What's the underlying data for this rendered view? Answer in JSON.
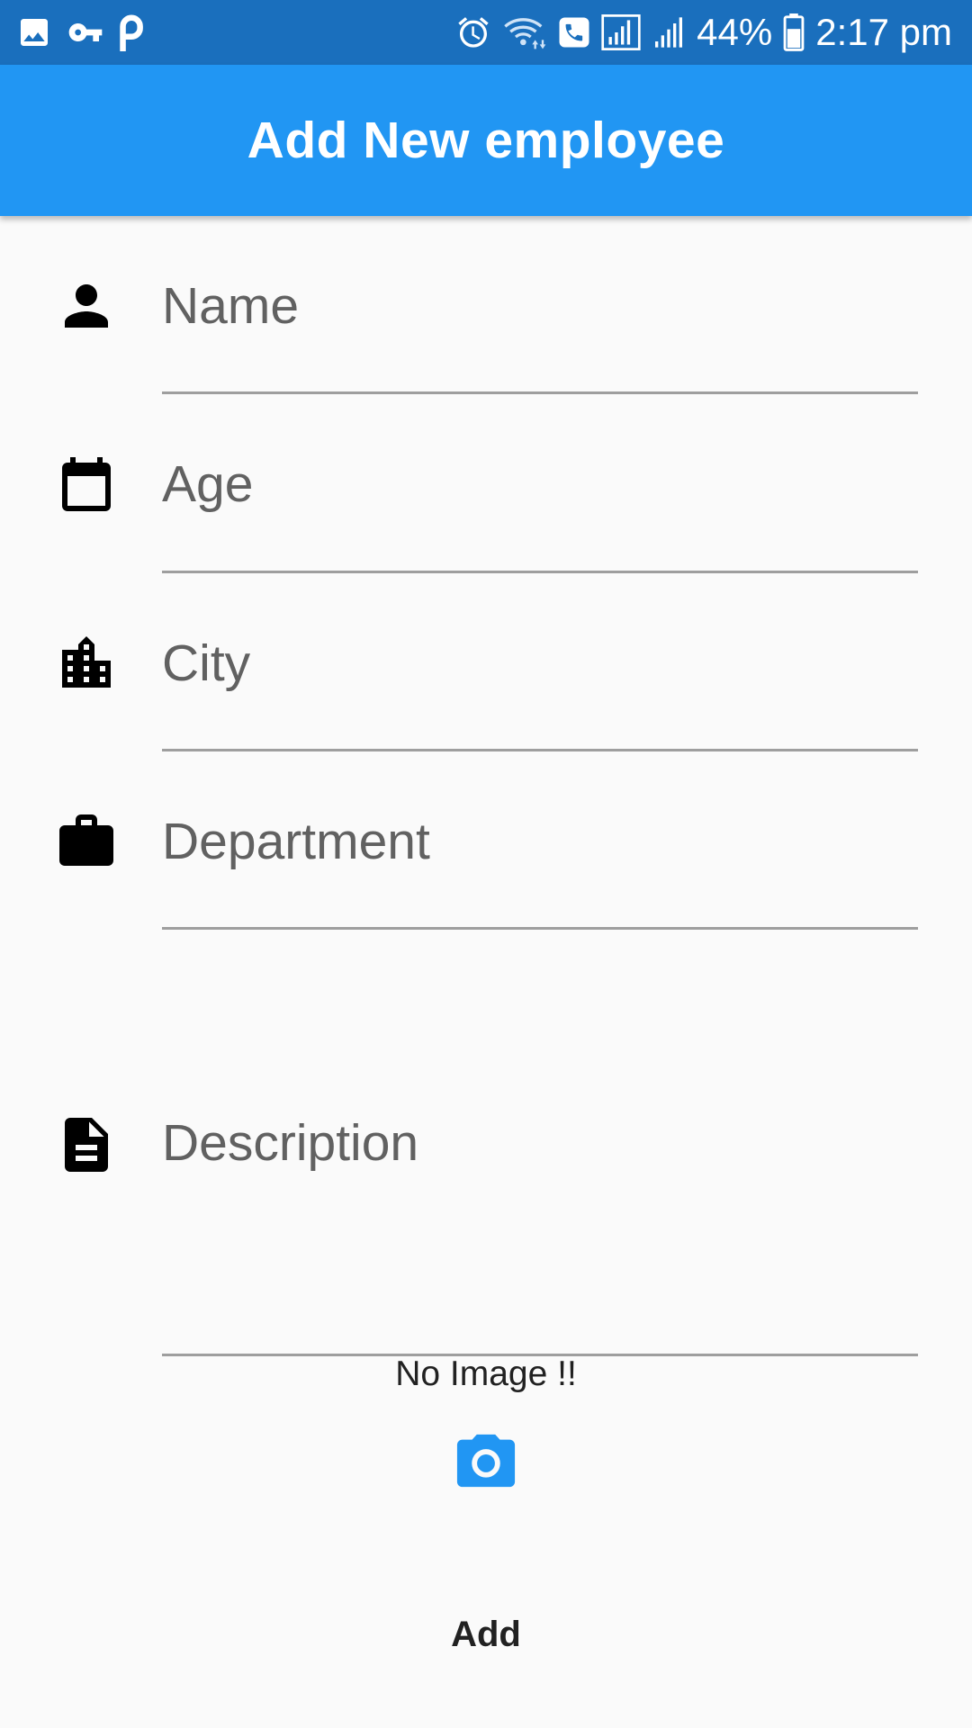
{
  "status_bar": {
    "left_icons": [
      "image-icon",
      "key-icon",
      "p-icon"
    ],
    "right_icons": [
      "alarm-icon",
      "wifi-calling-icon",
      "phone-icon",
      "signal-icon",
      "signal-icon",
      "battery-icon"
    ],
    "battery_percent": "44%",
    "time": "2:17 pm"
  },
  "app_bar": {
    "title": "Add New employee",
    "color": "#2196f3"
  },
  "form": {
    "fields": [
      {
        "icon": "person-icon",
        "placeholder": "Name",
        "value": ""
      },
      {
        "icon": "calendar-icon",
        "placeholder": "Age",
        "value": ""
      },
      {
        "icon": "city-icon",
        "placeholder": "City",
        "value": ""
      },
      {
        "icon": "work-icon",
        "placeholder": "Department",
        "value": ""
      },
      {
        "icon": "description-icon",
        "placeholder": "Description",
        "value": ""
      }
    ]
  },
  "image_section": {
    "status_text": "No Image !!",
    "camera_icon": "camera-icon"
  },
  "actions": {
    "add_label": "Add"
  },
  "colors": {
    "status_bar": "#1a6fbd",
    "accent": "#2196f3",
    "underline": "#9e9e9e"
  }
}
